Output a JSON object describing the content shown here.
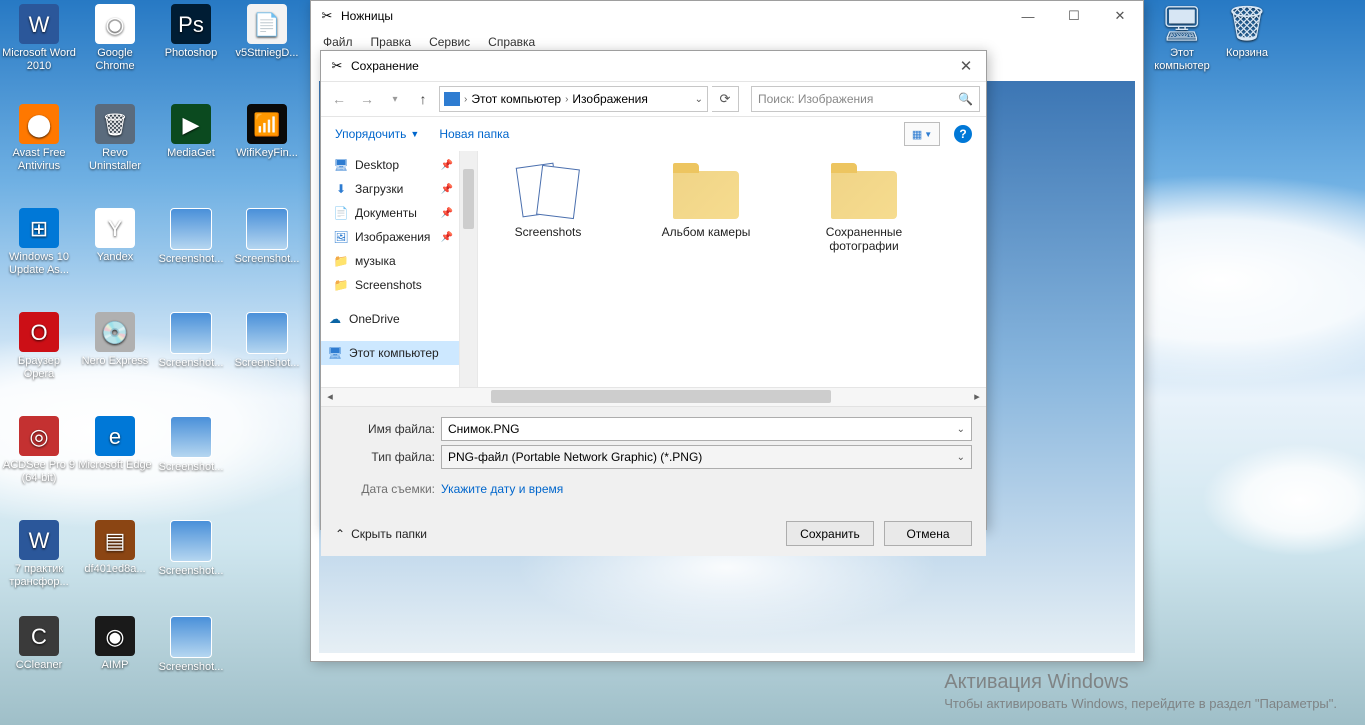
{
  "desktop": {
    "icons": [
      {
        "label": "Microsoft Word 2010",
        "bg": "#2b579a",
        "glyph": "W"
      },
      {
        "label": "Google Chrome",
        "bg": "#fff",
        "glyph": "◉"
      },
      {
        "label": "Photoshop",
        "bg": "#001d34",
        "glyph": "Ps"
      },
      {
        "label": "v5SttniegD...",
        "bg": "#f3f3f3",
        "glyph": "📄"
      },
      {
        "label": "Avast Free Antivirus",
        "bg": "#ff7800",
        "glyph": "⬤"
      },
      {
        "label": "Revo Uninstaller",
        "bg": "#5a6b7d",
        "glyph": "🗑"
      },
      {
        "label": "MediaGet",
        "bg": "#0b4a1f",
        "glyph": "▶"
      },
      {
        "label": "WifiKeyFin...",
        "bg": "#0a0a0a",
        "glyph": "📶"
      },
      {
        "label": "Windows 10 Update As...",
        "bg": "#0078d7",
        "glyph": "⊞"
      },
      {
        "label": "Yandex",
        "bg": "#ffffff",
        "glyph": "Y"
      },
      {
        "label": "Screenshot...",
        "thumb": true
      },
      {
        "label": "Screenshot...",
        "thumb": true
      },
      {
        "label": "Браузер Opera",
        "bg": "#cc0f16",
        "glyph": "O"
      },
      {
        "label": "Nero Express",
        "bg": "#b0b0b0",
        "glyph": "💿"
      },
      {
        "label": "Screenshot...",
        "thumb": true
      },
      {
        "label": "Screenshot...",
        "thumb": true
      },
      {
        "label": "ACDSee Pro 9 (64-bit)",
        "bg": "#c43131",
        "glyph": "◎"
      },
      {
        "label": "Microsoft Edge",
        "bg": "#0078d7",
        "glyph": "e"
      },
      {
        "label": "Screenshot...",
        "thumb": true
      },
      {
        "label": "7 практик трансфор...",
        "bg": "#2b579a",
        "glyph": "W"
      },
      {
        "label": "df401ed8a...",
        "bg": "#8b4513",
        "glyph": "▤"
      },
      {
        "label": "Screenshot...",
        "thumb": true
      },
      {
        "label": "CCleaner",
        "bg": "#3a3a3a",
        "glyph": "C"
      },
      {
        "label": "AIMP",
        "bg": "#1a1a1a",
        "glyph": "◉"
      },
      {
        "label": "Screenshot...",
        "thumb": true
      }
    ],
    "right": [
      {
        "label": "Этот компьютер",
        "glyph": "🖥"
      },
      {
        "label": "Корзина",
        "glyph": "🗑"
      }
    ]
  },
  "snip": {
    "title": "Ножницы",
    "menu": [
      "Файл",
      "Правка",
      "Сервис",
      "Справка"
    ]
  },
  "save": {
    "title": "Сохранение",
    "breadcrumb": {
      "root": "Этот компьютер",
      "leaf": "Изображения"
    },
    "search_placeholder": "Поиск: Изображения",
    "organize": "Упорядочить",
    "newfolder": "Новая папка",
    "tree": [
      {
        "label": "Desktop",
        "icon": "🖥",
        "color": "#2e7cd1",
        "pin": true
      },
      {
        "label": "Загрузки",
        "icon": "⬇",
        "color": "#2e7cd1",
        "pin": true
      },
      {
        "label": "Документы",
        "icon": "📄",
        "color": "#6d8aa8",
        "pin": true
      },
      {
        "label": "Изображения",
        "icon": "🖼",
        "color": "#2e7cd1",
        "pin": true
      },
      {
        "label": "музыка",
        "icon": "📁",
        "color": "#eac56a",
        "pin": false
      },
      {
        "label": "Screenshots",
        "icon": "📁",
        "color": "#eac56a",
        "pin": false
      },
      {
        "label": "OneDrive",
        "icon": "☁",
        "color": "#0a64a4",
        "pin": false,
        "onedrive": true
      },
      {
        "label": "Этот компьютер",
        "icon": "🖥",
        "color": "#2e7cd1",
        "pin": false,
        "sel": true
      }
    ],
    "folders": [
      {
        "label": "Screenshots",
        "kind": "screenshots"
      },
      {
        "label": "Альбом камеры",
        "kind": "folder"
      },
      {
        "label": "Сохраненные фотографии",
        "kind": "folder"
      }
    ],
    "filename_label": "Имя файла:",
    "filename_value": "Снимок.PNG",
    "filetype_label": "Тип файла:",
    "filetype_value": "PNG-файл (Portable Network Graphic) (*.PNG)",
    "date_label": "Дата съемки:",
    "date_link": "Укажите дату и время",
    "hide_folders": "Скрыть папки",
    "save_btn": "Сохранить",
    "cancel_btn": "Отмена"
  },
  "watermark": {
    "title": "Активация Windows",
    "body": "Чтобы активировать Windows, перейдите в раздел \"Параметры\"."
  }
}
